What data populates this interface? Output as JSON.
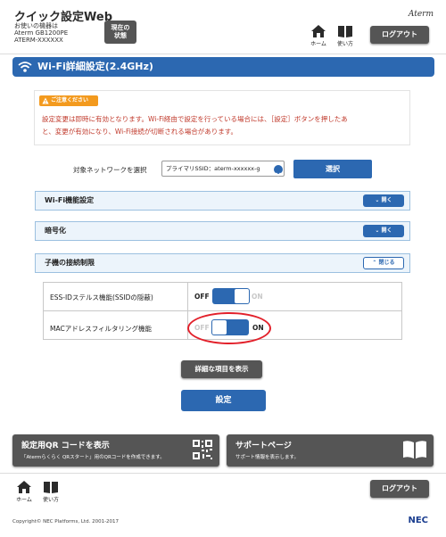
{
  "header": {
    "app_title": "クイック設定Web",
    "device_label": "お使いの機器は",
    "device_model": "Aterm GB1200PE",
    "device_name": "ATERM-XXXXXX",
    "status_button_line1": "現在の",
    "status_button_line2": "状態",
    "brand": "Aterm",
    "home_label": "ホーム",
    "help_label": "使い方",
    "logout_label": "ログアウト"
  },
  "page": {
    "title": "Wi-Fi詳細設定(2.4GHz)"
  },
  "notice": {
    "badge": "ご注意ください",
    "line1": "設定変更は即時に有効となります。Wi-Fi経由で設定を行っている場合には、［設定］ボタンを押したあ",
    "line2": "と、変更が有効になり、Wi-Fi接続が切断される場合があります。"
  },
  "network": {
    "label": "対象ネットワークを選択",
    "selected": "プライマリSSID：aterm-xxxxxx-g",
    "select_button": "選択"
  },
  "panels": [
    {
      "label": "Wi-Fi機能設定",
      "button": "開く",
      "state": "collapsed"
    },
    {
      "label": "暗号化",
      "button": "開く",
      "state": "collapsed"
    },
    {
      "label": "子機の接続制限",
      "button": "閉じる",
      "state": "expanded"
    }
  ],
  "settings": [
    {
      "label": "ESS-IDステルス機能(SSIDの隠蔽)",
      "off": "OFF",
      "on": "ON",
      "value": "OFF"
    },
    {
      "label": "MACアドレスフィルタリング機能",
      "off": "OFF",
      "on": "ON",
      "value": "ON"
    }
  ],
  "buttons": {
    "details": "詳細な項目を表示",
    "apply": "設定"
  },
  "cards": {
    "qr_title": "設定用QR コードを表示",
    "qr_sub": "「Atermらくらく QRスタート」用のQRコードを作成できます。",
    "support_title": "サポートページ",
    "support_sub": "サポート情報を表示します。"
  },
  "footer": {
    "home_label": "ホーム",
    "help_label": "使い方",
    "logout_label": "ログアウト",
    "copyright": "Copyright© NEC Platforms, Ltd. 2001-2017",
    "logo": "NEC"
  },
  "colors": {
    "accent": "#2c68b1",
    "dark_button": "#555555",
    "warning_badge": "#f39a1e",
    "notice_text": "#c0392b",
    "highlight_ring": "#e2202a"
  },
  "icons": [
    "home-icon",
    "book-icon",
    "wifi-icon",
    "warning-icon",
    "chevron-down-icon",
    "chevron-up-icon",
    "qr-code-icon",
    "book-open-icon"
  ]
}
